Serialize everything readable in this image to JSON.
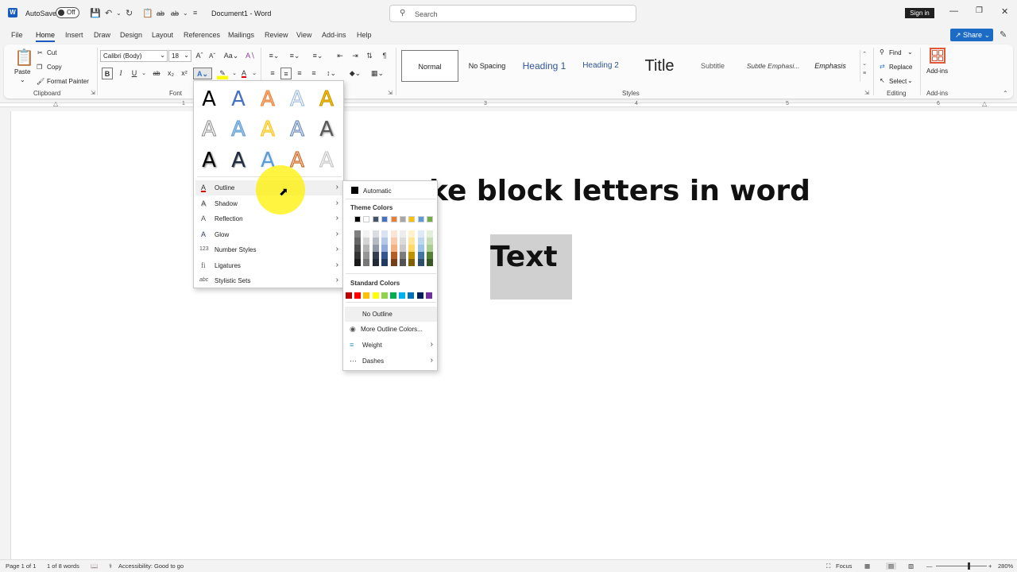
{
  "titlebar": {
    "autosave_label": "AutoSave",
    "autosave_state": "Off",
    "doc_title": "Document1 - Word",
    "search_placeholder": "Search",
    "signin_label": "Sign in"
  },
  "tabs": [
    "File",
    "Home",
    "Insert",
    "Draw",
    "Design",
    "Layout",
    "References",
    "Mailings",
    "Review",
    "View",
    "Add-ins",
    "Help"
  ],
  "share_label": "Share",
  "ribbon": {
    "clipboard": {
      "paste": "Paste",
      "cut": "Cut",
      "copy": "Copy",
      "format_painter": "Format Painter",
      "label": "Clipboard"
    },
    "font": {
      "name": "Calibri (Body)",
      "size": "18",
      "label": "Font"
    },
    "paragraph_label": "Paragraph",
    "styles": [
      "Normal",
      "No Spacing",
      "Heading 1",
      "Heading 2",
      "Title",
      "Subtitle",
      "Subtle Emphasi...",
      "Emphasis"
    ],
    "styles_label": "Styles",
    "editing": {
      "find": "Find",
      "replace": "Replace",
      "select": "Select",
      "label": "Editing"
    },
    "addins": {
      "button": "Add-ins",
      "label": "Add-ins"
    }
  },
  "ruler_numbers": [
    "1",
    "2",
    "3",
    "4",
    "5",
    "6"
  ],
  "document": {
    "heading_visible": "ke block letters in word",
    "box_text": "Text"
  },
  "text_effects_menu": {
    "items": [
      {
        "label": "Outline",
        "icon": "outline-icon"
      },
      {
        "label": "Shadow",
        "icon": "shadow-icon"
      },
      {
        "label": "Reflection",
        "icon": "reflection-icon"
      },
      {
        "label": "Glow",
        "icon": "glow-icon"
      },
      {
        "label": "Number Styles",
        "icon": "number-styles-icon"
      },
      {
        "label": "Ligatures",
        "icon": "ligatures-icon"
      },
      {
        "label": "Stylistic Sets",
        "icon": "stylistic-sets-icon"
      }
    ]
  },
  "outline_menu": {
    "automatic": "Automatic",
    "theme_colors_label": "Theme Colors",
    "standard_colors_label": "Standard Colors",
    "no_outline": "No Outline",
    "more_colors": "More Outline Colors...",
    "weight": "Weight",
    "dashes": "Dashes",
    "theme_top_row": [
      "#000000",
      "#ffffff",
      "#44546a",
      "#4472c4",
      "#ed7d31",
      "#a5a5a5",
      "#ffc000",
      "#5b9bd5",
      "#70ad47"
    ],
    "standard_colors": [
      "#c00000",
      "#ff0000",
      "#ffc000",
      "#ffff00",
      "#92d050",
      "#00b050",
      "#00b0f0",
      "#0070c0",
      "#002060",
      "#7030a0"
    ]
  },
  "status": {
    "page": "Page 1 of 1",
    "words": "1 of 8 words",
    "accessibility": "Accessibility: Good to go",
    "focus": "Focus",
    "zoom": "280%"
  }
}
